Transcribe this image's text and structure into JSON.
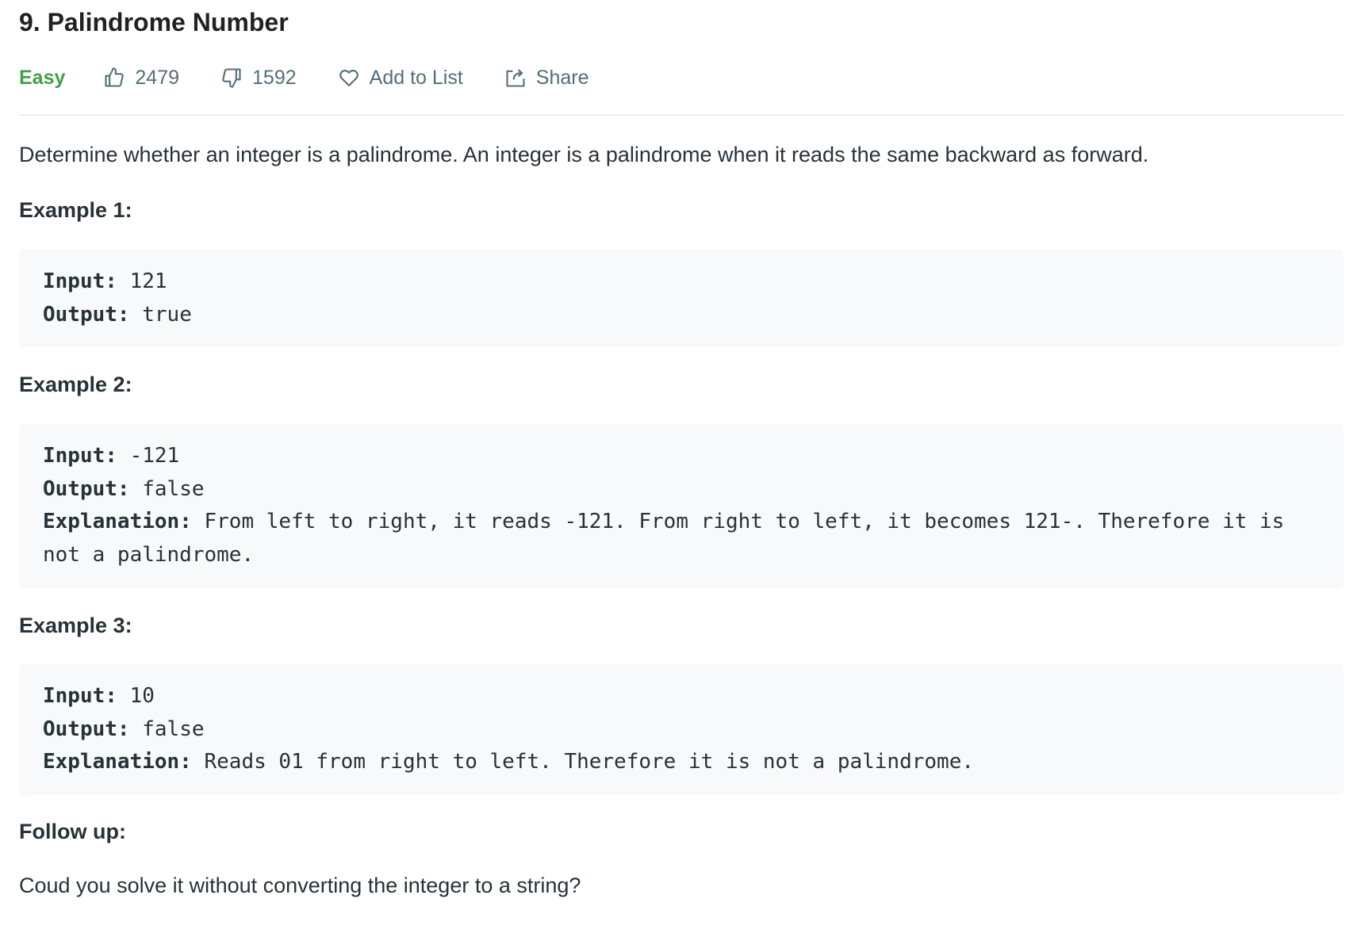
{
  "problem": {
    "title": "9. Palindrome Number",
    "difficulty": "Easy",
    "likes": "2479",
    "dislikes": "1592",
    "add_to_list": "Add to List",
    "share": "Share",
    "description": "Determine whether an integer is a palindrome. An integer is a palindrome when it reads the same backward as forward."
  },
  "labels": {
    "input": "Input:",
    "output": "Output:",
    "explanation": "Explanation:"
  },
  "examples": [
    {
      "heading": "Example 1:",
      "input": "121",
      "output": "true"
    },
    {
      "heading": "Example 2:",
      "input": "-121",
      "output": "false",
      "explanation_line1": "From left to right, it reads -121. From right to left, it becomes 121-. Therefore it is",
      "explanation_line2": "not a palindrome."
    },
    {
      "heading": "Example 3:",
      "input": "10",
      "output": "false",
      "explanation_line1": "Reads 01 from right to left. Therefore it is not a palindrome."
    }
  ],
  "follow_up": {
    "heading": "Follow up:",
    "text": "Coud you solve it without converting the integer to a string?"
  },
  "colors": {
    "easy": "#43a047",
    "meta_text": "#546e7a",
    "code_bg": "#f7f9fa",
    "divider": "#eeeeee"
  },
  "icons": [
    "thumbs-up-icon",
    "thumbs-down-icon",
    "heart-icon",
    "share-icon"
  ]
}
